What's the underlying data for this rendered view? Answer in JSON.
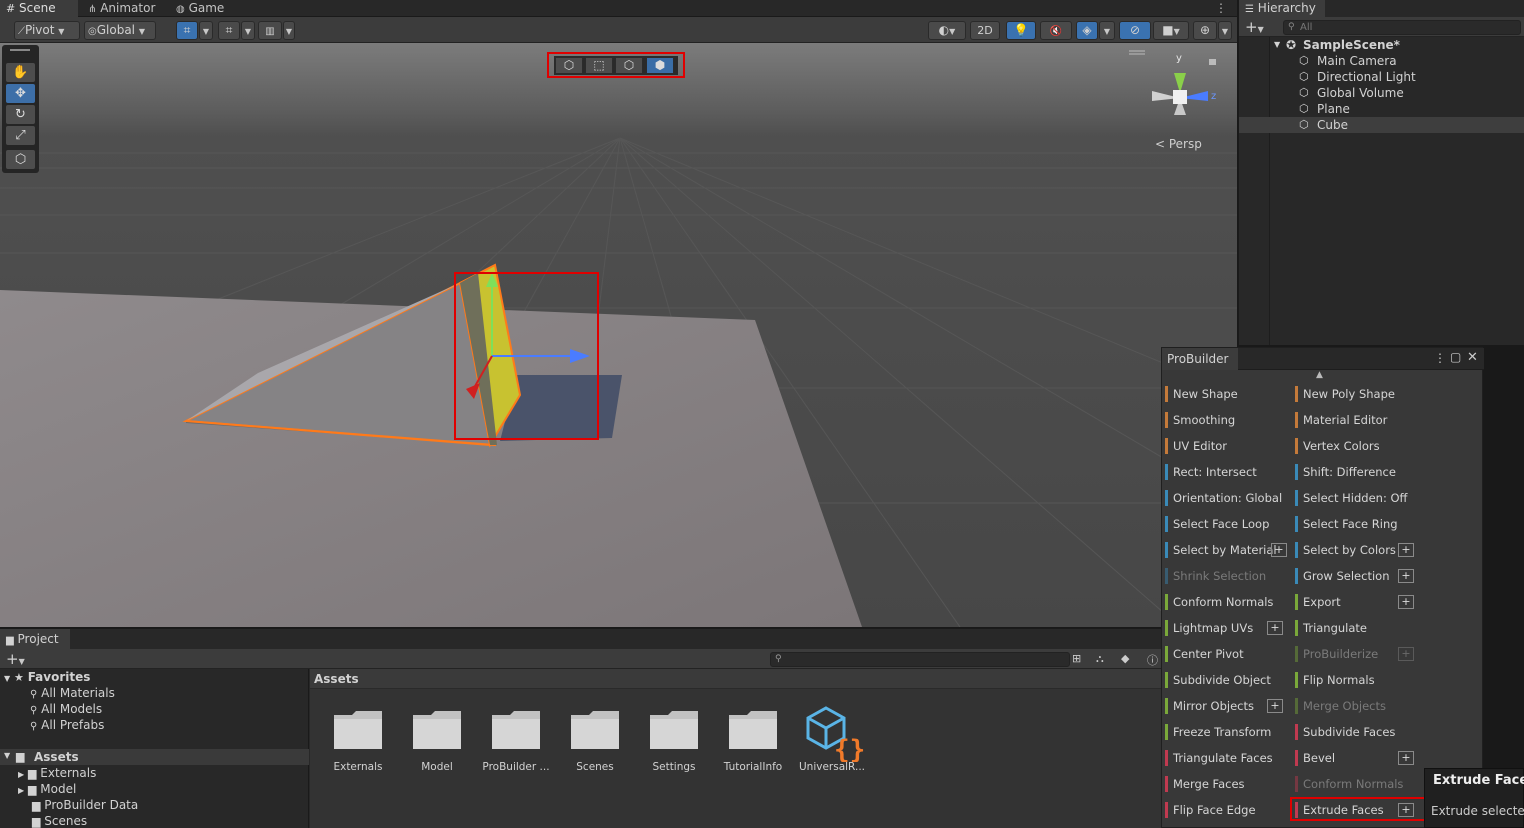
{
  "tabs": {
    "scene": "Scene",
    "animator": "Animator",
    "game": "Game"
  },
  "toolbar": {
    "pivot": "Pivot",
    "global": "Global",
    "view_2d": "2D"
  },
  "gizmo": {
    "y_label": "y",
    "z_label": "z",
    "persp_label": "< Persp"
  },
  "hierarchy": {
    "title": "Hierarchy",
    "search_placeholder": "All",
    "scene_name": "SampleScene*",
    "items": [
      "Main Camera",
      "Directional Light",
      "Global Volume",
      "Plane",
      "Cube"
    ]
  },
  "probuilder": {
    "title": "ProBuilder",
    "left": [
      {
        "label": "New Shape",
        "color": "#c47a3a"
      },
      {
        "label": "Smoothing",
        "color": "#c47a3a"
      },
      {
        "label": "UV Editor",
        "color": "#c47a3a"
      },
      {
        "label": "Rect: Intersect",
        "color": "#3a8ab8"
      },
      {
        "label": "Orientation: Global",
        "color": "#3a8ab8"
      },
      {
        "label": "Select Face Loop",
        "color": "#3a8ab8"
      },
      {
        "label": "Select by Material",
        "color": "#3a8ab8"
      },
      {
        "label": "Shrink Selection",
        "color": "#3a8ab8"
      },
      {
        "label": "Conform Normals",
        "color": "#7aa83a"
      },
      {
        "label": "Lightmap UVs",
        "color": "#7aa83a"
      },
      {
        "label": "Center Pivot",
        "color": "#7aa83a"
      },
      {
        "label": "Subdivide Object",
        "color": "#7aa83a"
      },
      {
        "label": "Mirror Objects",
        "color": "#7aa83a"
      },
      {
        "label": "Freeze Transform",
        "color": "#7aa83a"
      },
      {
        "label": "Triangulate Faces",
        "color": "#c03a50"
      },
      {
        "label": "Merge Faces",
        "color": "#c03a50"
      },
      {
        "label": "Flip Face Edge",
        "color": "#c03a50"
      }
    ],
    "right": [
      {
        "label": "New Poly Shape",
        "color": "#c47a3a"
      },
      {
        "label": "Material Editor",
        "color": "#c47a3a"
      },
      {
        "label": "Vertex Colors",
        "color": "#c47a3a"
      },
      {
        "label": "Shift: Difference",
        "color": "#3a8ab8"
      },
      {
        "label": "Select Hidden: Off",
        "color": "#3a8ab8"
      },
      {
        "label": "Select Face Ring",
        "color": "#3a8ab8"
      },
      {
        "label": "Select by Colors",
        "color": "#3a8ab8"
      },
      {
        "label": "Grow Selection",
        "color": "#3a8ab8"
      },
      {
        "label": "Export",
        "color": "#7aa83a"
      },
      {
        "label": "Triangulate",
        "color": "#7aa83a"
      },
      {
        "label": "ProBuilderize",
        "color": "#7aa83a"
      },
      {
        "label": "Flip Normals",
        "color": "#7aa83a"
      },
      {
        "label": "Merge Objects",
        "color": "#7aa83a"
      },
      {
        "label": "Subdivide Faces",
        "color": "#c03a50"
      },
      {
        "label": "Bevel",
        "color": "#c03a50"
      },
      {
        "label": "Conform Normals",
        "color": "#c03a50"
      },
      {
        "label": "Extrude Faces",
        "color": "#c03a50"
      }
    ],
    "plus_label": "+"
  },
  "tooltip": {
    "title": "Extrude Faces",
    "body": "Extrude selected"
  },
  "project": {
    "title": "Project",
    "favorites": "Favorites",
    "fav_items": [
      "All Materials",
      "All Models",
      "All Prefabs"
    ],
    "assets_root": "Assets",
    "tree_items": [
      "Externals",
      "Model",
      "ProBuilder Data",
      "Scenes"
    ],
    "assets_header": "Assets",
    "assets": [
      "Externals",
      "Model",
      "ProBuilder ...",
      "Scenes",
      "Settings",
      "TutorialInfo",
      "UniversalR..."
    ]
  }
}
